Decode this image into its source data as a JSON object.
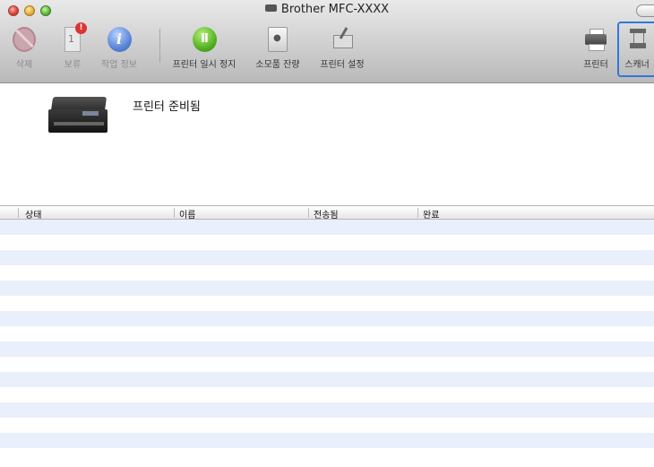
{
  "window": {
    "title": "Brother MFC-XXXX"
  },
  "toolbar": {
    "delete_label": "삭제",
    "hold_label": "보류",
    "hold_badge": "!",
    "hold_number": "1",
    "info_label": "작업 정보",
    "pause_label": "프린터 일시 정지",
    "supply_label": "소모품 잔량",
    "setup_label": "프린터 설정",
    "printer_label": "프린터",
    "scanner_label": "스캐너"
  },
  "printer": {
    "status": "프린터 준비됨"
  },
  "table": {
    "columns": [
      "상태",
      "이름",
      "전송됨",
      "완료"
    ],
    "rows": []
  }
}
